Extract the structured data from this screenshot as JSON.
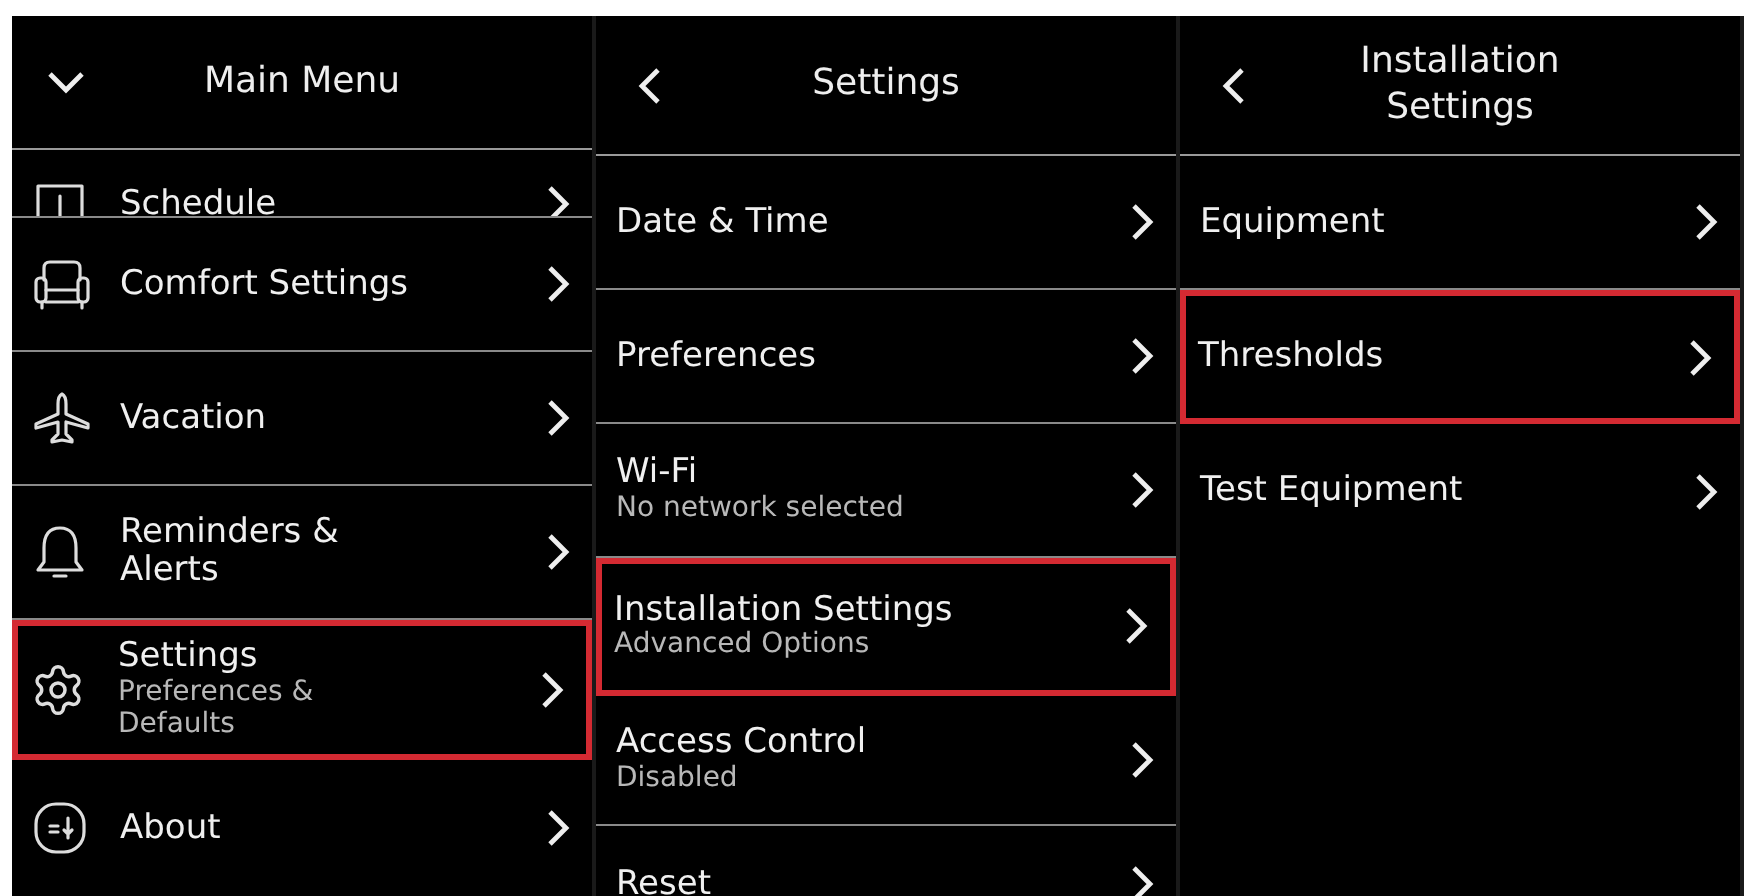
{
  "panels": [
    {
      "title": "Main Menu",
      "items": [
        {
          "label": "Schedule",
          "highlighted": false
        },
        {
          "label": "Comfort Settings",
          "highlighted": false
        },
        {
          "label": "Vacation",
          "highlighted": false
        },
        {
          "label": "Reminders &\nAlerts",
          "highlighted": false
        },
        {
          "label": "Settings",
          "subtitle": "Preferences &\nDefaults",
          "highlighted": true
        },
        {
          "label": "About",
          "highlighted": false
        }
      ]
    },
    {
      "title": "Settings",
      "items": [
        {
          "label": "Date & Time",
          "highlighted": false
        },
        {
          "label": "Preferences",
          "highlighted": false
        },
        {
          "label": "Wi-Fi",
          "subtitle": "No network selected",
          "highlighted": false
        },
        {
          "label": "Installation Settings",
          "subtitle": "Advanced Options",
          "highlighted": true
        },
        {
          "label": "Access Control",
          "subtitle": "Disabled",
          "highlighted": false
        },
        {
          "label": "Reset",
          "highlighted": false
        }
      ]
    },
    {
      "title": "Installation\nSettings",
      "items": [
        {
          "label": "Equipment",
          "highlighted": false
        },
        {
          "label": "Thresholds",
          "highlighted": true
        },
        {
          "label": "Test Equipment",
          "highlighted": false
        }
      ]
    }
  ]
}
